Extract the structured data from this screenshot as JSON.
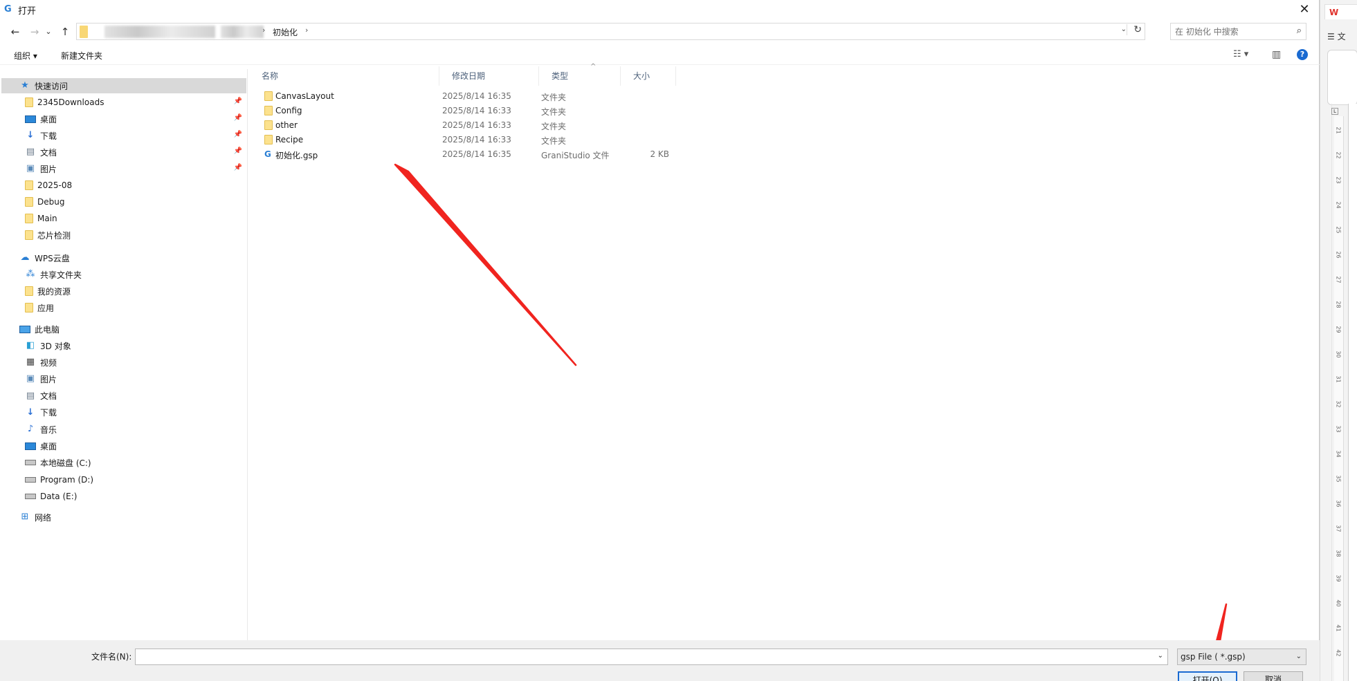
{
  "dialog": {
    "title": "打开",
    "close_glyph": "✕"
  },
  "nav": {
    "back_glyph": "←",
    "forward_glyph": "→",
    "recent_glyph": "⌄",
    "up_glyph": "↑",
    "path_separator": "›",
    "current_folder": "初始化",
    "dropdown_glyph": "⌄",
    "refresh_glyph": "↻",
    "search_placeholder": "在 初始化 中搜索",
    "search_glyph": "⌕"
  },
  "toolbar": {
    "organize_label": "组织 ▾",
    "new_folder_label": "新建文件夹",
    "view_glyph": "☷ ▾",
    "preview_glyph": "▥",
    "help_glyph": "?"
  },
  "sidebar": {
    "pin_glyph": "📌",
    "quick_access": "快速访问",
    "quick_items": [
      {
        "label": "2345Downloads",
        "icon": "folder",
        "pinned": true
      },
      {
        "label": "桌面",
        "icon": "desktop",
        "pinned": true
      },
      {
        "label": "下载",
        "icon": "download",
        "pinned": true
      },
      {
        "label": "文档",
        "icon": "document",
        "pinned": true
      },
      {
        "label": "图片",
        "icon": "picture",
        "pinned": true
      },
      {
        "label": "2025-08",
        "icon": "folder",
        "pinned": false
      },
      {
        "label": "Debug",
        "icon": "folder",
        "pinned": false
      },
      {
        "label": "Main",
        "icon": "folder",
        "pinned": false
      },
      {
        "label": "芯片检测",
        "icon": "folder",
        "pinned": false
      }
    ],
    "wps_cloud": "WPS云盘",
    "wps_items": [
      {
        "label": "共享文件夹",
        "icon": "share"
      },
      {
        "label": "我的资源",
        "icon": "folder"
      },
      {
        "label": "应用",
        "icon": "folder"
      }
    ],
    "this_pc": "此电脑",
    "pc_items": [
      {
        "label": "3D 对象",
        "icon": "cube"
      },
      {
        "label": "视频",
        "icon": "video"
      },
      {
        "label": "图片",
        "icon": "picture"
      },
      {
        "label": "文档",
        "icon": "document"
      },
      {
        "label": "下载",
        "icon": "download"
      },
      {
        "label": "音乐",
        "icon": "music"
      },
      {
        "label": "桌面",
        "icon": "desktop"
      },
      {
        "label": "本地磁盘 (C:)",
        "icon": "drive"
      },
      {
        "label": "Program (D:)",
        "icon": "drive"
      },
      {
        "label": "Data (E:)",
        "icon": "drive"
      }
    ],
    "network": "网络"
  },
  "filelist": {
    "headers": {
      "name": "名称",
      "date": "修改日期",
      "type": "类型",
      "size": "大小"
    },
    "sort_glyph": "^",
    "rows": [
      {
        "name": "CanvasLayout",
        "date": "2025/8/14 16:35",
        "type": "文件夹",
        "size": "",
        "kind": "folder"
      },
      {
        "name": "Config",
        "date": "2025/8/14 16:33",
        "type": "文件夹",
        "size": "",
        "kind": "folder"
      },
      {
        "name": "other",
        "date": "2025/8/14 16:33",
        "type": "文件夹",
        "size": "",
        "kind": "folder"
      },
      {
        "name": "Recipe",
        "date": "2025/8/14 16:33",
        "type": "文件夹",
        "size": "",
        "kind": "folder"
      },
      {
        "name": "初始化.gsp",
        "date": "2025/8/14 16:35",
        "type": "GraniStudio 文件",
        "size": "2 KB",
        "kind": "gsp"
      }
    ]
  },
  "bottom": {
    "filename_label": "文件名(N):",
    "filename_value": "",
    "filter_value": "gsp File ( *.gsp)",
    "dropdown_glyph": "⌄",
    "open_label": "打开(O)",
    "cancel_label": "取消"
  },
  "background_app": {
    "tab_label": "W",
    "menu_label": "☰ 文",
    "ruler_corner": "L",
    "ruler_ticks": [
      "21",
      "22",
      "23",
      "24",
      "25",
      "26",
      "27",
      "28",
      "29",
      "30",
      "31",
      "32",
      "33",
      "34",
      "35",
      "36",
      "37",
      "38",
      "39",
      "40",
      "41",
      "42"
    ]
  },
  "colors": {
    "accent": "#1a6ad1",
    "annotation_arrow": "#f0241f",
    "folder": "#fce28e"
  }
}
